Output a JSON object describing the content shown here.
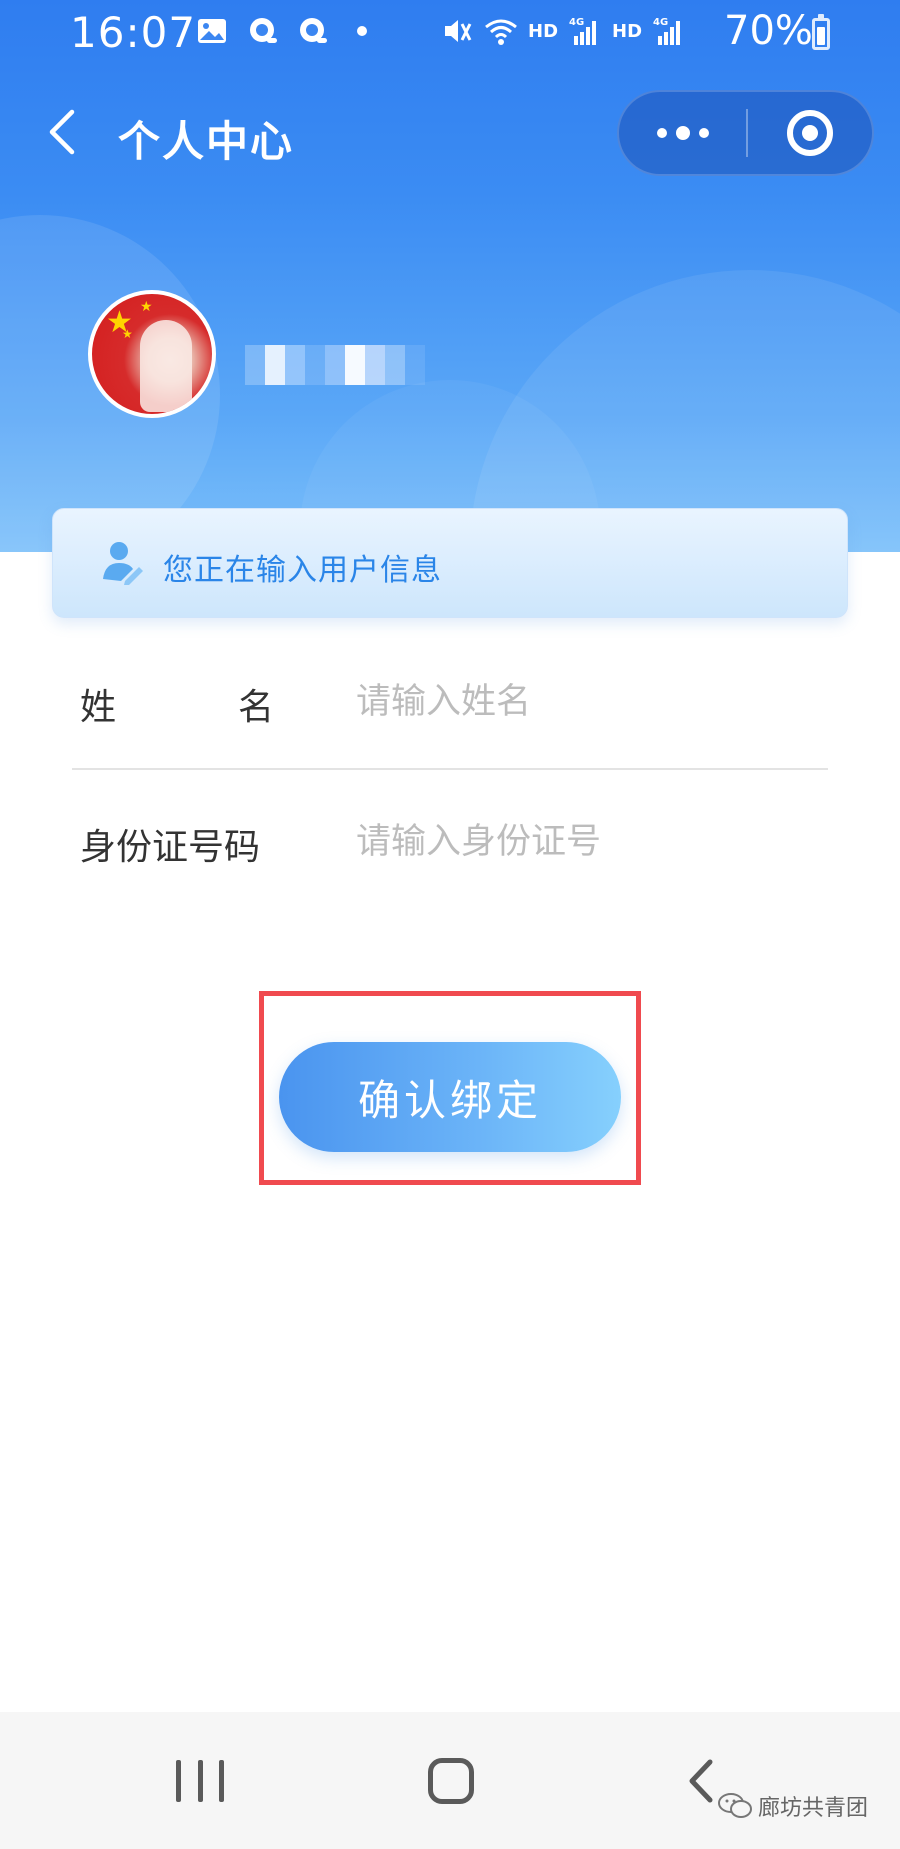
{
  "status_bar": {
    "time": "16:07",
    "icons": [
      "image-icon",
      "qq-icon",
      "qq-icon",
      "mute-icon",
      "wifi-icon",
      "signal-icon",
      "signal-icon"
    ],
    "hd1": "HD",
    "hd2": "HD",
    "battery": "70%"
  },
  "nav": {
    "title": "个人中心"
  },
  "profile": {
    "avatar_icon": "avatar-icon"
  },
  "banner": {
    "text": "您正在输入用户信息",
    "icon": "user-edit-icon"
  },
  "form": {
    "name_label_chars": [
      "姓",
      "名"
    ],
    "name_placeholder": "请输入姓名",
    "name_value": "",
    "id_label": "身份证号码",
    "id_placeholder": "请输入身份证号",
    "id_value": ""
  },
  "actions": {
    "confirm_label": "确认绑定"
  },
  "watermark": {
    "text": "廊坊共青团"
  },
  "colors": {
    "header_blue": "#2f7df0",
    "accent_text": "#2a85e8",
    "highlight_red": "#f04a4f"
  }
}
